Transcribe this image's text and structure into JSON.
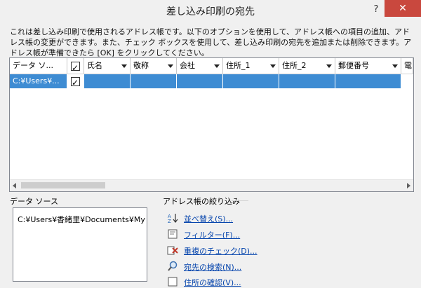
{
  "window": {
    "title": "差し込み印刷の宛先",
    "help": "?",
    "close": "✕"
  },
  "description": "これは差し込み印刷で使用されるアドレス帳です。以下のオプションを使用して、アドレス帳への項目の追加、アドレス帳の変更ができます。また、チェック ボックスを使用して、差し込み印刷の宛先を追加または削除できます。アドレス帳が準備できたら [OK] をクリックしてください。",
  "grid": {
    "columns": [
      "データ ソ...",
      "",
      "氏名",
      "敬称",
      "会社",
      "住所_1",
      "住所_2",
      "郵便番号",
      "電"
    ],
    "rows": [
      {
        "source": "C:¥Users¥...",
        "checked": true
      }
    ]
  },
  "data_source": {
    "label": "データ ソース",
    "item": "C:¥Users¥香緒里¥Documents¥My"
  },
  "refine": {
    "label": "アドレス帳の絞り込み",
    "links": [
      "並べ替え(S)...",
      "フィルター(F)...",
      "重複のチェック(D)...",
      "宛先の検索(N)...",
      "住所の確認(V)..."
    ]
  }
}
